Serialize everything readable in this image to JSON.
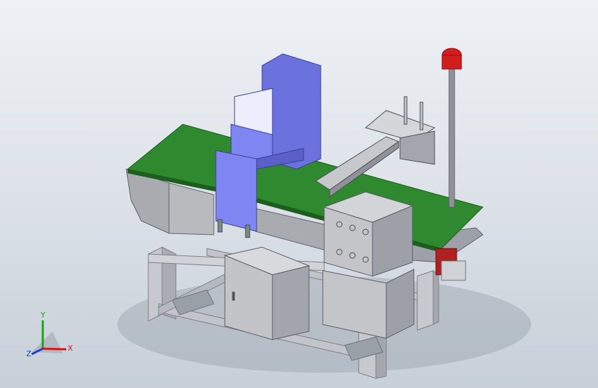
{
  "viewport": {
    "background_top": "#eef1f5",
    "background_bottom": "#c7cfd8"
  },
  "model": {
    "parts": {
      "detector_color": "#7f86f2",
      "belt_color": "#2f8a2f",
      "frame_color": "#c9cbd1",
      "panel_color": "#b7b8bb",
      "beacon_color": "#d11d1d",
      "motor_color": "#b12020"
    }
  },
  "triad": {
    "x_label": "X",
    "y_label": "Y",
    "z_label": "Z",
    "x_color": "#d01818",
    "y_color": "#1aa31a",
    "z_color": "#2040d0"
  }
}
